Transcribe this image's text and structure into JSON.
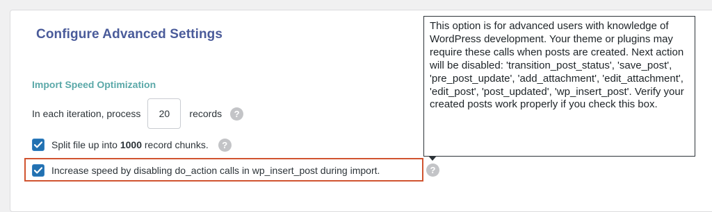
{
  "page": {
    "title": "Configure Advanced Settings"
  },
  "import_speed": {
    "heading": "Import Speed Optimization",
    "iteration": {
      "prefix": "In each iteration, process",
      "value": "20",
      "suffix": "records"
    },
    "split_file": {
      "checked": true,
      "prefix": "Split file up into",
      "count": "1000",
      "suffix": "record chunks."
    },
    "disable_actions": {
      "checked": true,
      "label": "Increase speed by disabling do_action calls in wp_insert_post during import."
    }
  },
  "tooltip": {
    "text": "This option is for advanced users with knowledge of WordPress development. Your theme or plugins may require these calls when posts are created. Next action will be disabled: 'transition_post_status', 'save_post', 'pre_post_update', 'add_attachment', 'edit_attachment', 'edit_post', 'post_updated', 'wp_insert_post'. Verify your created posts work properly if you check this box."
  },
  "icons": {
    "help": "question-mark-circle-icon",
    "checkbox": "checkmark-icon"
  },
  "help_glyph": "?",
  "colors": {
    "title": "#4a5b9a",
    "section_heading": "#5aa8a8",
    "checkbox": "#2271b1",
    "highlight_border": "#d0532f",
    "help_icon": "#c3c4c7"
  }
}
